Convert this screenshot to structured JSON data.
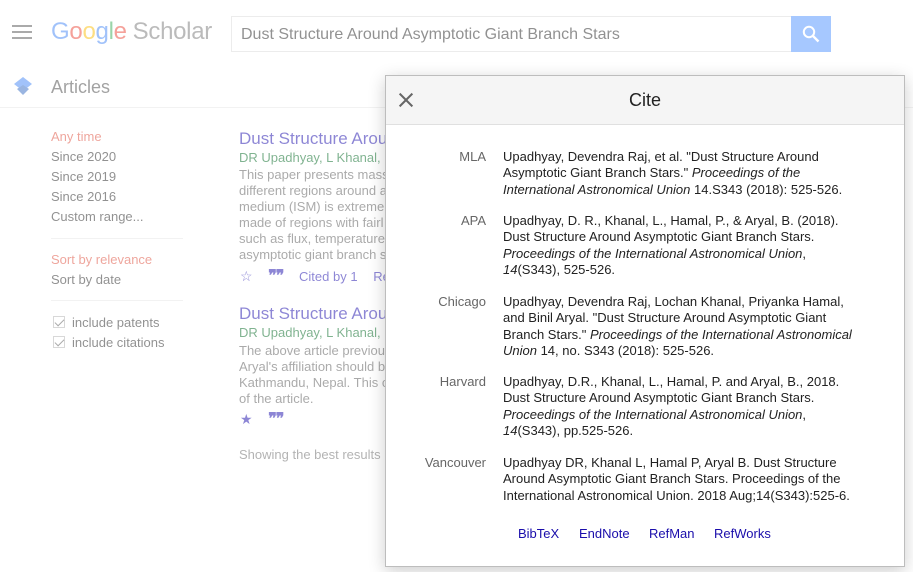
{
  "header": {
    "logo_letters": [
      "G",
      "o",
      "o",
      "g",
      "l",
      "e"
    ],
    "logo_suffix": "Scholar",
    "search_value": "Dust Structure Around Asymptotic Giant Branch Stars"
  },
  "subheader": {
    "label": "Articles"
  },
  "sidebar": {
    "time_filters": [
      "Any time",
      "Since 2020",
      "Since 2019",
      "Since 2016",
      "Custom range..."
    ],
    "sort_options": [
      "Sort by relevance",
      "Sort by date"
    ],
    "checkboxes": [
      "include patents",
      "include citations"
    ]
  },
  "results": [
    {
      "title": "Dust Structure Arou",
      "authors": "DR Upadhyay, L Khanal,",
      "snippet": [
        "This paper presents mass",
        "different regions around a",
        "medium (ISM) is extreme",
        "made of regions with fairl",
        "such as flux, temperature",
        "asymptotic giant branch s"
      ],
      "cited_by": "Cited by 1",
      "related": "Re"
    },
    {
      "title": "Dust Structure Arou",
      "authors": "DR Upadhyay, L Khanal,",
      "snippet": [
        "The above article previou",
        "Aryal's affiliation should b",
        "Kathmandu, Nepal. This c",
        "of the article."
      ]
    }
  ],
  "showing_text": "Showing the best results",
  "dialog": {
    "title": "Cite",
    "citations": [
      {
        "style": "MLA",
        "lines": [
          "Upadhyay, Devendra Raj, et al. \"Dust Structure Around",
          "Asymptotic Giant Branch Stars.\" <i>Proceedings of the</i>",
          "<i>International Astronomical Union</i> 14.S343 (2018): 525-526."
        ]
      },
      {
        "style": "APA",
        "lines": [
          "Upadhyay, D. R., Khanal, L., Hamal, P., & Aryal, B. (2018).",
          "Dust Structure Around Asymptotic Giant Branch Stars.",
          "<i>Proceedings of the International Astronomical Union</i>,",
          "<i>14</i>(S343), 525-526."
        ]
      },
      {
        "style": "Chicago",
        "lines": [
          "Upadhyay, Devendra Raj, Lochan Khanal, Priyanka Hamal,",
          "and Binil Aryal. \"Dust Structure Around Asymptotic Giant",
          "Branch Stars.\" <i>Proceedings of the International Astronomical</i>",
          "<i>Union</i> 14, no. S343 (2018): 525-526."
        ]
      },
      {
        "style": "Harvard",
        "lines": [
          "Upadhyay, D.R., Khanal, L., Hamal, P. and Aryal, B., 2018.",
          "Dust Structure Around Asymptotic Giant Branch Stars.",
          "<i>Proceedings of the International Astronomical Union</i>,",
          "<i>14</i>(S343), pp.525-526."
        ]
      },
      {
        "style": "Vancouver",
        "lines": [
          "Upadhyay DR, Khanal L, Hamal P, Aryal B. Dust Structure",
          "Around Asymptotic Giant Branch Stars. Proceedings of the",
          "International Astronomical Union. 2018 Aug;14(S343):525-6."
        ]
      }
    ],
    "exports": [
      "BibTeX",
      "EndNote",
      "RefMan",
      "RefWorks"
    ]
  }
}
